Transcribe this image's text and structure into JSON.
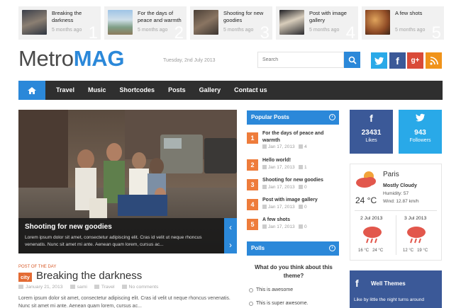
{
  "top_strip": [
    {
      "title": "Breaking the darkness",
      "time": "5 months ago",
      "num": "1"
    },
    {
      "title": "For the days of peace and warmth",
      "time": "5 months ago",
      "num": "2"
    },
    {
      "title": "Shooting for new goodies",
      "time": "5 months ago",
      "num": "3"
    },
    {
      "title": "Post with image gallery",
      "time": "5 months ago",
      "num": "4"
    },
    {
      "title": "A few shots",
      "time": "5 months ago",
      "num": "5"
    }
  ],
  "header": {
    "logo_part1": "Metro",
    "logo_part2": "MAG",
    "date": "Tuesday, 2nd July 2013",
    "search_placeholder": "Search",
    "social": [
      {
        "name": "twitter-icon",
        "glyph": "t",
        "color": "#29a9e8"
      },
      {
        "name": "facebook-icon",
        "glyph": "f",
        "color": "#3b5998"
      },
      {
        "name": "google-plus-icon",
        "glyph": "g+",
        "color": "#d94a38"
      },
      {
        "name": "rss-icon",
        "glyph": "rss",
        "color": "#f0931a"
      }
    ]
  },
  "nav": {
    "items": [
      "Travel",
      "Music",
      "Shortcodes",
      "Posts",
      "Gallery",
      "Contact us"
    ]
  },
  "slider": {
    "title": "Shooting for new goodies",
    "text": "Lorem ipsum dolor sit amet, consectetur adipiscing elit. Cras id velit ut neque rhoncus venenatis. Nunc sit amet mi ante. Aenean quam lorem, cursus ac..."
  },
  "featured_post": {
    "label": "POST OF THE DAY",
    "category": "city",
    "title": "Breaking the darkness",
    "date": "January 21, 2013",
    "author": "sami",
    "section": "Travel",
    "comments": "No comments",
    "excerpt": "Lorem ipsum dolor sit amet, consectetur adipiscing elit. Cras id velit ut neque rhoncus venenatis. Nunc sit amet mi ante. Aenean quam lorem, cursus ac..."
  },
  "popular": {
    "title": "Popular Posts",
    "items": [
      {
        "num": "1",
        "title": "For the days of peace and warmth",
        "date": "Jan 17, 2013",
        "comments": "4"
      },
      {
        "num": "2",
        "title": "Hello world!",
        "date": "Jan 17, 2013",
        "comments": "1"
      },
      {
        "num": "3",
        "title": "Shooting for new goodies",
        "date": "Jan 17, 2013",
        "comments": "0"
      },
      {
        "num": "4",
        "title": "Post with image gallery",
        "date": "Jan 17, 2013",
        "comments": "0"
      },
      {
        "num": "5",
        "title": "A few shots",
        "date": "Jan 17, 2013",
        "comments": "0"
      }
    ]
  },
  "polls": {
    "title": "Polls",
    "question": "What do you think about this theme?",
    "options": [
      "This is awesome",
      "This is super awesome."
    ]
  },
  "facebook": {
    "count": "23431",
    "label": "Likes"
  },
  "twitter": {
    "count": "943",
    "label": "Followers"
  },
  "weather": {
    "city": "Paris",
    "condition": "Mostly Cloudy",
    "humidity": "Humidity: 57",
    "wind": "Wind: 12.87 km/h",
    "temp": "24 °C",
    "forecast": [
      {
        "date": "2 Jul 2013",
        "low": "16 °C",
        "high": "24 °C"
      },
      {
        "date": "3 Jul 2013",
        "low": "12 °C",
        "high": "19 °C"
      }
    ]
  },
  "well_themes": {
    "title": "Well Themes",
    "text": "Like by little the night turns around"
  },
  "colors": {
    "accent": "#2b88d9",
    "orange": "#ee7c3b",
    "nav_bg": "#2f2f2f"
  }
}
